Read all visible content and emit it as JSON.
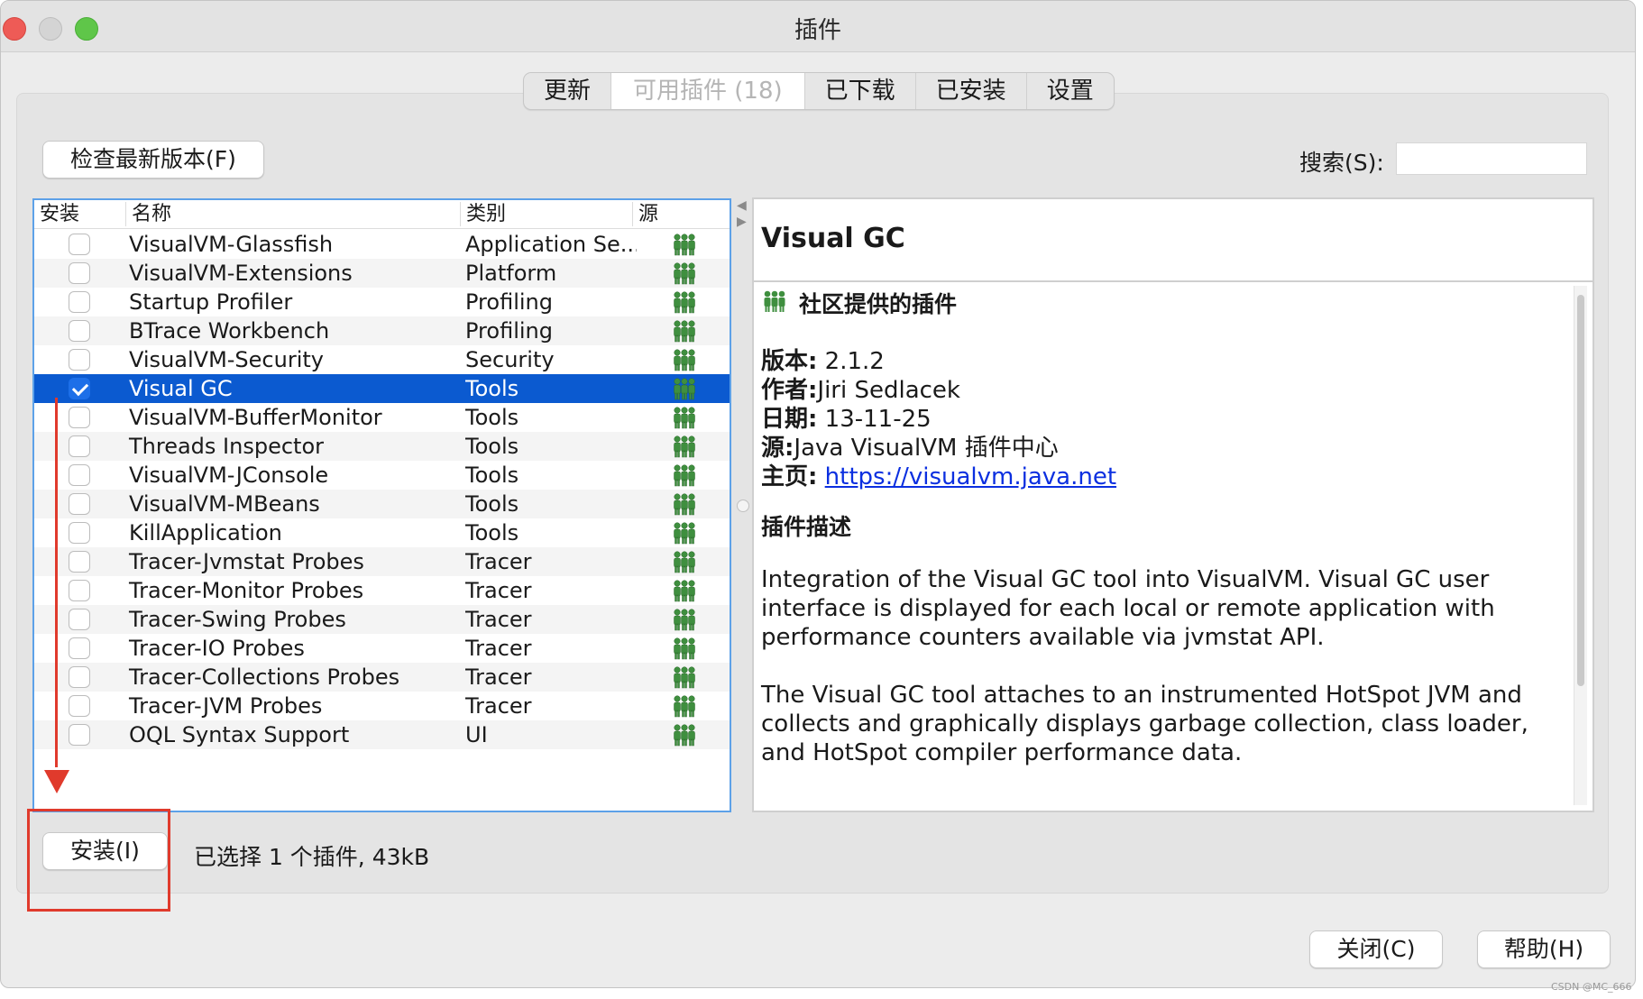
{
  "window": {
    "title": "插件"
  },
  "tabs": [
    {
      "label": "更新",
      "active": false
    },
    {
      "label": "可用插件 (18)",
      "active": true
    },
    {
      "label": "已下载",
      "active": false
    },
    {
      "label": "已安装",
      "active": false
    },
    {
      "label": "设置",
      "active": false
    }
  ],
  "toolbar": {
    "check_updates_label": "检查最新版本(F)"
  },
  "search": {
    "label": "搜索(S):",
    "value": ""
  },
  "table": {
    "headers": {
      "install": "安装",
      "name": "名称",
      "category": "类别",
      "source": "源"
    },
    "rows": [
      {
        "checked": false,
        "name": "VisualVM-Glassfish",
        "category": "Application Se...",
        "selected": false
      },
      {
        "checked": false,
        "name": "VisualVM-Extensions",
        "category": "Platform",
        "selected": false
      },
      {
        "checked": false,
        "name": "Startup Profiler",
        "category": "Profiling",
        "selected": false
      },
      {
        "checked": false,
        "name": "BTrace Workbench",
        "category": "Profiling",
        "selected": false
      },
      {
        "checked": false,
        "name": "VisualVM-Security",
        "category": "Security",
        "selected": false
      },
      {
        "checked": true,
        "name": "Visual GC",
        "category": "Tools",
        "selected": true
      },
      {
        "checked": false,
        "name": "VisualVM-BufferMonitor",
        "category": "Tools",
        "selected": false
      },
      {
        "checked": false,
        "name": "Threads Inspector",
        "category": "Tools",
        "selected": false
      },
      {
        "checked": false,
        "name": "VisualVM-JConsole",
        "category": "Tools",
        "selected": false
      },
      {
        "checked": false,
        "name": "VisualVM-MBeans",
        "category": "Tools",
        "selected": false
      },
      {
        "checked": false,
        "name": "KillApplication",
        "category": "Tools",
        "selected": false
      },
      {
        "checked": false,
        "name": "Tracer-Jvmstat Probes",
        "category": "Tracer",
        "selected": false
      },
      {
        "checked": false,
        "name": "Tracer-Monitor Probes",
        "category": "Tracer",
        "selected": false
      },
      {
        "checked": false,
        "name": "Tracer-Swing Probes",
        "category": "Tracer",
        "selected": false
      },
      {
        "checked": false,
        "name": "Tracer-IO Probes",
        "category": "Tracer",
        "selected": false
      },
      {
        "checked": false,
        "name": "Tracer-Collections Probes",
        "category": "Tracer",
        "selected": false
      },
      {
        "checked": false,
        "name": "Tracer-JVM Probes",
        "category": "Tracer",
        "selected": false
      },
      {
        "checked": false,
        "name": "OQL Syntax Support",
        "category": "UI",
        "selected": false
      }
    ]
  },
  "detail": {
    "title": "Visual GC",
    "community_label": "社区提供的插件",
    "version_label": "版本:",
    "version": "2.1.2",
    "author_label": "作者:",
    "author": "Jiri Sedlacek",
    "date_label": "日期:",
    "date": "13-11-25",
    "source_label": "源:",
    "source": "Java VisualVM 插件中心",
    "homepage_label": "主页:",
    "homepage": "https://visualvm.java.net",
    "description_heading": "插件描述",
    "description_p1": "Integration of the Visual GC tool into VisualVM. Visual GC user interface is displayed for each local or remote application with performance counters available via jvmstat API.",
    "description_p2": "The Visual GC tool attaches to an instrumented HotSpot JVM and collects and graphically displays garbage collection, class loader, and HotSpot compiler performance data."
  },
  "footer": {
    "install_label": "安装(I)",
    "status": "已选择 1 个插件, 43kB",
    "close_label": "关闭(C)",
    "help_label": "帮助(H)"
  },
  "watermark": "CSDN @MC_666",
  "colors": {
    "selection": "#0b5ad0",
    "annotation": "#e03a2c",
    "link": "#0b2fe0",
    "icon": "#3f8f3f"
  }
}
